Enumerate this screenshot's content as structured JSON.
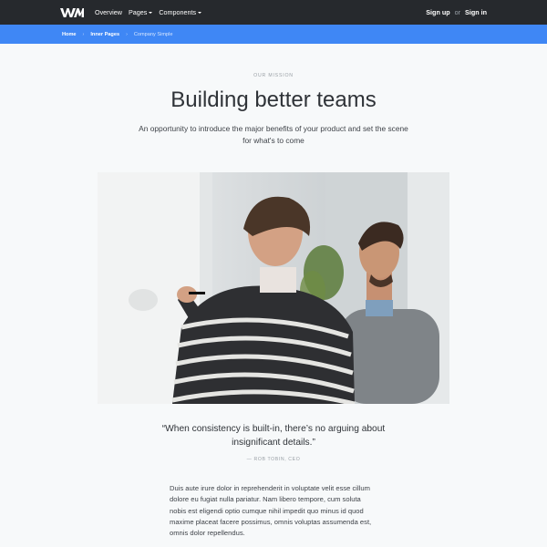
{
  "nav": {
    "logo_text": "WM",
    "links": [
      {
        "label": "Overview"
      },
      {
        "label": "Pages"
      },
      {
        "label": "Components"
      }
    ],
    "sign_up": "Sign up",
    "or": "or",
    "sign_in": "Sign in"
  },
  "breadcrumb": {
    "home": "Home",
    "inner": "Inner Pages",
    "current": "Company Simple",
    "separator": "›"
  },
  "hero": {
    "eyebrow": "OUR MISSION",
    "title": "Building better teams",
    "lead": "An opportunity to introduce the major benefits of your product and set the scene for what's to come"
  },
  "quote": {
    "text": "“When consistency is built-in, there’s no arguing about insignificant details.”",
    "cite": "— ROB TOBIN, CEO"
  },
  "body": {
    "paragraph": "Duis aute irure dolor in reprehenderit in voluptate velit esse cillum dolore eu fugiat nulla pariatur. Nam libero tempore, cum soluta nobis est eligendi optio cumque nihil impedit quo minus id quod maxime placeat facere possimus, omnis voluptas assumenda est, omnis dolor repellendus."
  },
  "colors": {
    "navbar": "#26292d",
    "breadcrumb_bar": "#3f87f5",
    "page_bg": "#f7f9fa"
  }
}
